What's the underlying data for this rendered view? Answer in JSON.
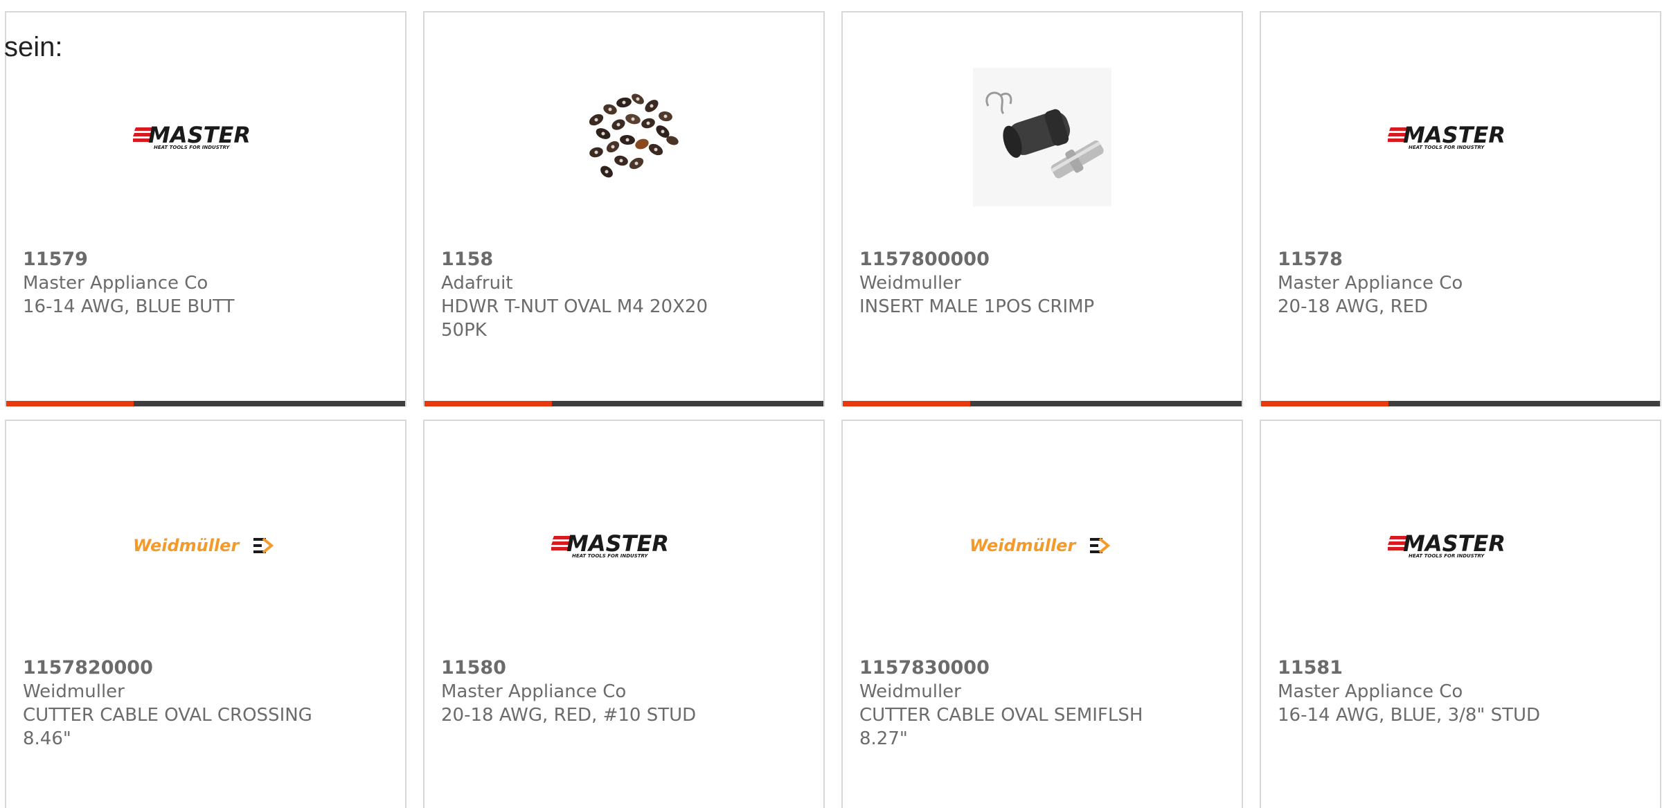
{
  "overlay_text": "sein:",
  "colors": {
    "border": "#d8d8d8",
    "text": "#6b6b6b",
    "bar_dark": "#3e3e3e",
    "bar_accent": "#e8380d",
    "master_red": "#d71920",
    "weidmuller_orange": "#f39a2b"
  },
  "brands": {
    "master": {
      "name": "MASTER",
      "tagline": "HEAT TOOLS FOR INDUSTRY"
    },
    "weidmuller": {
      "name": "Weidmüller"
    }
  },
  "products": [
    {
      "part_number": "11579",
      "manufacturer": "Master Appliance Co",
      "description": "16-14 AWG, BLUE BUTT",
      "image": "master-logo",
      "progress": 0.32
    },
    {
      "part_number": "1158",
      "manufacturer": "Adafruit",
      "description": "HDWR T-NUT OVAL M4 20X20 50PK",
      "image": "t-nut-photo",
      "progress": 0.32
    },
    {
      "part_number": "1157800000",
      "manufacturer": "Weidmuller",
      "description": "INSERT MALE 1POS CRIMP",
      "image": "insert-photo",
      "progress": 0.32
    },
    {
      "part_number": "11578",
      "manufacturer": "Master Appliance Co",
      "description": "20-18 AWG, RED",
      "image": "master-logo",
      "progress": 0.32
    },
    {
      "part_number": "1157820000",
      "manufacturer": "Weidmuller",
      "description": "CUTTER CABLE OVAL CROSSING 8.46\"",
      "image": "weidmuller-logo"
    },
    {
      "part_number": "11580",
      "manufacturer": "Master Appliance Co",
      "description": "20-18 AWG, RED, #10 STUD",
      "image": "master-logo"
    },
    {
      "part_number": "1157830000",
      "manufacturer": "Weidmuller",
      "description": "CUTTER CABLE OVAL SEMIFLSH 8.27\"",
      "image": "weidmuller-logo"
    },
    {
      "part_number": "11581",
      "manufacturer": "Master Appliance Co",
      "description": "16-14 AWG, BLUE, 3/8\" STUD",
      "image": "master-logo"
    }
  ]
}
